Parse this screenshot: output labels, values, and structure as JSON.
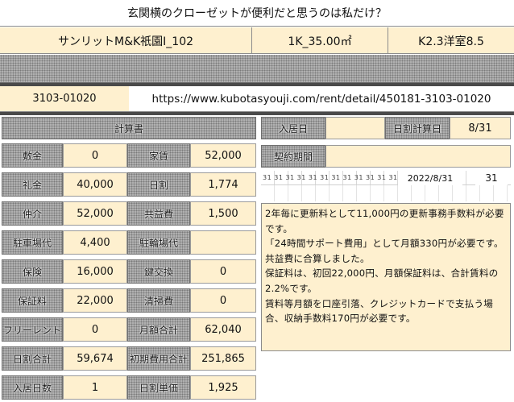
{
  "title": "玄関横のクローゼットが便利だと思うのは私だけ？",
  "property": {
    "name": "サンリットM&K祇園Ⅰ_102",
    "area": "1K_35.00㎡",
    "layout": "K2.3洋室8.5"
  },
  "url_row": {
    "id": "3103-01020",
    "url": "https://www.kubotasyouji.com/rent/detail/450181-3103-01020"
  },
  "left_table": {
    "header": "計算書",
    "rows": [
      {
        "l1": "敷金",
        "v1": "0",
        "l2": "家賃",
        "v2": "52,000"
      },
      {
        "l1": "礼金",
        "v1": "40,000",
        "l2": "日割",
        "v2": "1,774"
      },
      {
        "l1": "仲介",
        "v1": "52,000",
        "l2": "共益費",
        "v2": "1,500"
      },
      {
        "l1": "駐車場代",
        "v1": "4,400",
        "l2": "駐輪場代",
        "v2": ""
      },
      {
        "l1": "保険",
        "v1": "16,000",
        "l2": "鍵交換",
        "v2": "0"
      },
      {
        "l1": "保証料",
        "v1": "22,000",
        "l2": "清掃費",
        "v2": "0"
      },
      {
        "l1": "フリーレント",
        "v1": "0",
        "l2": "月額合計",
        "v2": "62,040"
      },
      {
        "l1": "日割合計",
        "v1": "59,674",
        "l2": "初期費用合計",
        "v2": "251,865"
      },
      {
        "l1": "入居日数",
        "v1": "1",
        "l2": "日割単価",
        "v2": "1,925"
      }
    ]
  },
  "right_panel": {
    "move_in_label": "入居日",
    "move_in_value": "",
    "calc_label": "日割計算日",
    "calc_value": "8/31",
    "contract_label": "契約期間",
    "contract_value": "",
    "tiny_strip": "31 31 31 31 31 31 31 31 31 31 31 31 31",
    "date": "2022/8/31",
    "days": "31"
  },
  "notes": [
    "2年毎に更新料として11,000円の更新事務手数料が必要です。",
    "「24時間サポート費用」として月額330円が必要です。共益費に合算しました。",
    "保証料は、初回22,000円、月額保証料は、合計賃料の2.2%です。",
    "賃料等月額を口座引落、クレジットカードで支払う場合、収納手数料170円が必要です。"
  ]
}
